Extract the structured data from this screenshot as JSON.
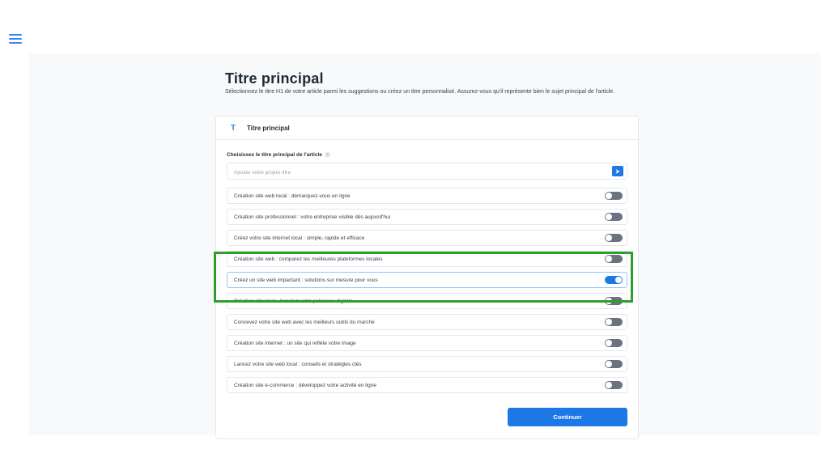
{
  "header": {
    "title": "Titre principal",
    "description": "Sélectionnez le titre H1 de votre article parmi les suggestions ou créez un titre personnalisé. Assurez-vous qu'il représente bien le sujet principal de l'article."
  },
  "card": {
    "header_icon": "T",
    "header_label": "Titre principal",
    "section_label": "Choisissez le titre principal de l'article",
    "help_icon": "?",
    "input": {
      "value": "",
      "placeholder": "Ajouter votre propre titre"
    },
    "options": [
      {
        "label": "Création site web local : démarquez-vous en ligne",
        "selected": false
      },
      {
        "label": "Création site professionnel : votre entreprise visible dès aujourd'hui",
        "selected": false
      },
      {
        "label": "Créez votre site internet local : simple, rapide et efficace",
        "selected": false
      },
      {
        "label": "Création site web : comparez les meilleures plateformes locales",
        "selected": false
      },
      {
        "label": "Créez un site web impactant : solutions sur mesure pour vous",
        "selected": true
      },
      {
        "label": "Création site local : boostez votre présence digitale",
        "selected": false
      },
      {
        "label": "Concevez votre site web avec les meilleurs outils du marché",
        "selected": false
      },
      {
        "label": "Création site internet : un site qui reflète votre image",
        "selected": false
      },
      {
        "label": "Lancez votre site web local : conseils et stratégies clés",
        "selected": false
      },
      {
        "label": "Création site e-commerce : développez votre activité en ligne",
        "selected": false
      }
    ],
    "continue_label": "Continuer"
  },
  "colors": {
    "accent": "#1d77e6",
    "highlight": "#2e9e2a",
    "toggle_off": "#6b7280"
  },
  "icons": {
    "menu": "hamburger-menu-icon",
    "send": "arrow-right-icon",
    "help": "help-circle-icon",
    "title": "t-letter-icon"
  }
}
